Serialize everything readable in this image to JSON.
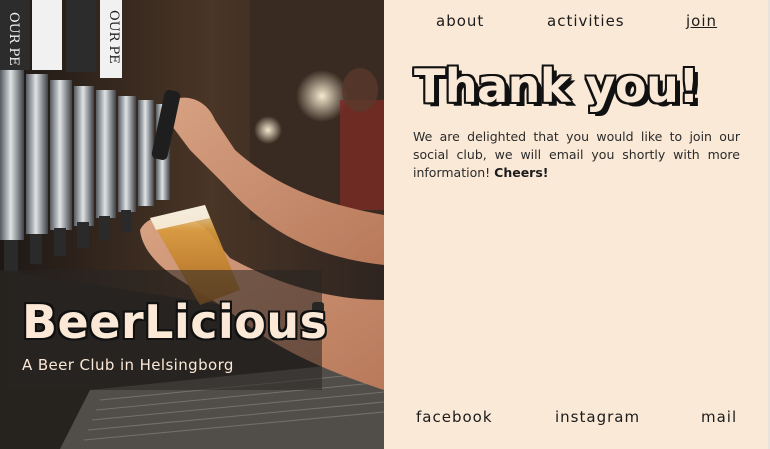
{
  "brand": {
    "name": "BeerLicious",
    "tagline": "A Beer Club in Helsingborg"
  },
  "nav": {
    "about": "about",
    "activities": "activities",
    "join": "join"
  },
  "main": {
    "heading": "Thank you!",
    "message": "We are delighted that you would like to join our social club, we will email you shortly with more information!",
    "message_emphasis": "Cheers!"
  },
  "footer": {
    "facebook": "facebook",
    "instagram": "instagram",
    "mail": "mail"
  },
  "colors": {
    "panel_background": "#fae9d7",
    "text": "#1c1c1c",
    "brand_text": "#fbe8d6"
  },
  "photo": {
    "tap_handle_text": "OUR PE"
  }
}
